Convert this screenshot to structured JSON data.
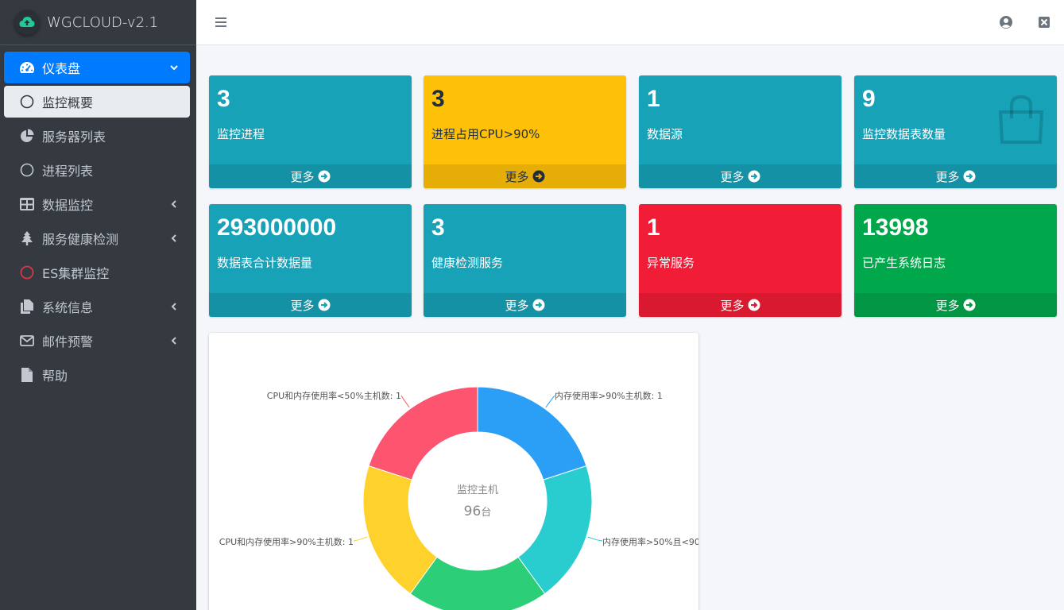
{
  "brand": {
    "title": "WGCLOUD-v2.1"
  },
  "sidebar": {
    "items": [
      {
        "label": "仪表盘",
        "icon": "tachometer-icon"
      },
      {
        "label": "监控概要",
        "icon": "circle-icon"
      },
      {
        "label": "服务器列表",
        "icon": "pie-chart-icon"
      },
      {
        "label": "进程列表",
        "icon": "circle-icon"
      },
      {
        "label": "数据监控",
        "icon": "table-icon"
      },
      {
        "label": "服务健康检测",
        "icon": "tree-icon"
      },
      {
        "label": "ES集群监控",
        "icon": "circle-icon-red"
      },
      {
        "label": "系统信息",
        "icon": "copy-icon"
      },
      {
        "label": "邮件预警",
        "icon": "envelope-icon"
      },
      {
        "label": "帮助",
        "icon": "file-icon"
      }
    ]
  },
  "boxes": [
    {
      "number": "3",
      "label": "监控进程",
      "more": "更多",
      "color": "#17a2b8"
    },
    {
      "number": "3",
      "label": "进程占用CPU>90%",
      "more": "更多",
      "color": "#ffc107"
    },
    {
      "number": "1",
      "label": "数据源",
      "more": "更多",
      "color": "#17a2b8"
    },
    {
      "number": "9",
      "label": "监控数据表数量",
      "more": "更多",
      "color": "#17a2b8"
    },
    {
      "number": "293000000",
      "label": "数据表合计数据量",
      "more": "更多",
      "color": "#17a2b8"
    },
    {
      "number": "3",
      "label": "健康检测服务",
      "more": "更多",
      "color": "#17a2b8"
    },
    {
      "number": "1",
      "label": "异常服务",
      "more": "更多",
      "color": "#dc3545"
    },
    {
      "number": "13998",
      "label": "已产生系统日志",
      "more": "更多",
      "color": "#28a745"
    }
  ],
  "chart_data": {
    "type": "pie",
    "title": "",
    "center_title": "监控主机",
    "center_value": "96",
    "center_unit": "台",
    "slices": [
      {
        "name": "内存使用率>90%主机数",
        "label": "内存使用率>90%主机数: 1",
        "value": 1,
        "color": "#2a9ff5"
      },
      {
        "name": "内存使用率>50%且<90",
        "label": "内存使用率>50%且<90",
        "value": 1,
        "color": "#29cccf"
      },
      {
        "name": "",
        "label": "",
        "value": 1,
        "color": "#2ccf78"
      },
      {
        "name": "CPU和内存使用率>90%主机数",
        "label": "CPU和内存使用率>90%主机数: 1",
        "value": 1,
        "color": "#fed12c"
      },
      {
        "name": "CPU和内存使用率<50%主机数",
        "label": "CPU和内存使用率<50%主机数: 1",
        "value": 1,
        "color": "#fd5470"
      }
    ]
  }
}
